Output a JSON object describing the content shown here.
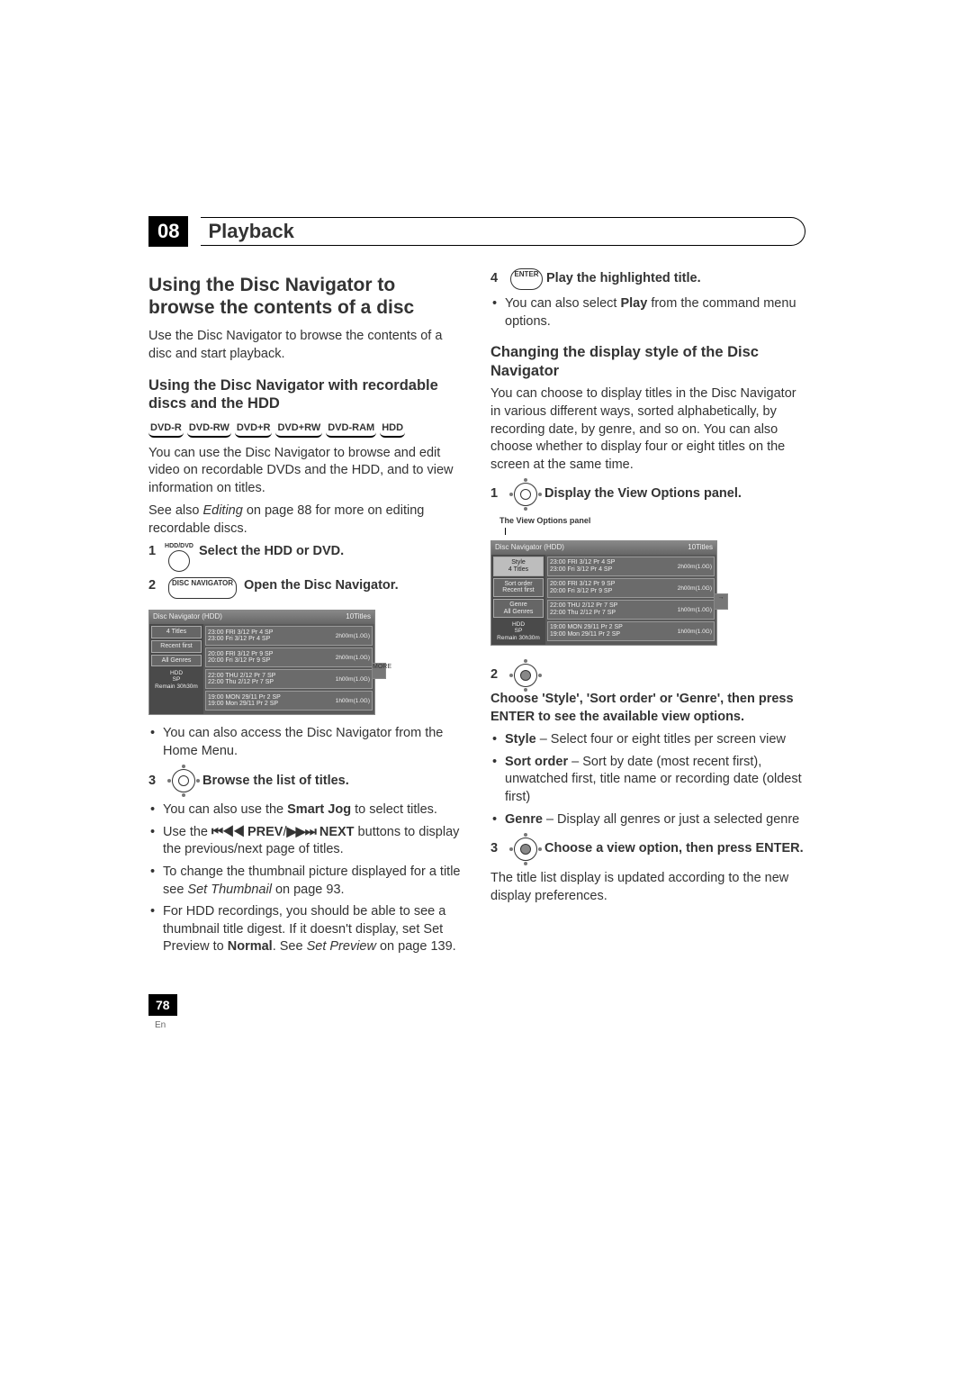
{
  "chapter": {
    "number": "08",
    "title": "Playback"
  },
  "left": {
    "main_heading": "Using the Disc Navigator to browse the contents of a disc",
    "intro": "Use the Disc Navigator to browse the contents of a disc and start playback.",
    "sub_heading": "Using the Disc Navigator with recordable discs and the HDD",
    "media_badges": [
      "DVD-R",
      "DVD-RW",
      "DVD+R",
      "DVD+RW",
      "DVD-RAM",
      "HDD"
    ],
    "para1": "You can use the Disc Navigator to browse and edit video on recordable DVDs and the HDD, and to view information on titles.",
    "para2_pre": "See also ",
    "para2_em": "Editing",
    "para2_post": " on page 88 for more on editing recordable discs.",
    "btn_hdddvd_label": "HDD/DVD",
    "step1_text": "Select the HDD or DVD.",
    "btn_discnav_label": "DISC NAVIGATOR",
    "step2_text": "Open the Disc Navigator.",
    "screenshot1": {
      "title": "Disc Navigator (HDD)",
      "count": "10Titles",
      "left_items": [
        {
          "label": "4 Titles"
        },
        {
          "label": "Recent first"
        },
        {
          "label": "All Genres"
        },
        {
          "label_top": "HDD",
          "label_mid": "SP",
          "label_bot": "Remain 30h30m"
        }
      ],
      "rows": [
        {
          "l1": "23:00 FRI  3/12  Pr 4  SP",
          "l2": "23:00 Fri  3/12  Pr 4  SP",
          "meta": "2h00m(1.0G)"
        },
        {
          "l1": "20:00 FRI  3/12  Pr 9  SP",
          "l2": "20:00 Fri  3/12  Pr 9  SP",
          "meta": "2h00m(1.0G)"
        },
        {
          "l1": "22:00 THU  2/12 Pr 7  SP",
          "l2": "22:00 Thu  2/12  Pr 7  SP",
          "meta": "1h00m(1.0G)"
        },
        {
          "l1": "19:00 MON 29/11 Pr 2  SP",
          "l2": "19:00 Mon 29/11  Pr 2  SP",
          "meta": "1h00m(1.0G)"
        }
      ],
      "more": "MORE"
    },
    "bullet_after_ss": "You can also access the Disc Navigator from the Home Menu.",
    "step3_text": "Browse the list of titles.",
    "b3_1_pre": "You can also use the ",
    "b3_1_bold": "Smart Jog",
    "b3_1_post": " to select titles.",
    "b3_2_pre": "Use the ",
    "b3_2_prev_sym": "⏮◀◀",
    "b3_2_prev": " PREV",
    "b3_2_slash": "/",
    "b3_2_next_sym": "▶▶⏭",
    "b3_2_next": " NEXT",
    "b3_2_post": " buttons to display the previous/next page of titles.",
    "b3_3_pre": "To change the thumbnail picture displayed for a title see ",
    "b3_3_em": "Set Thumbnail",
    "b3_3_post": " on page 93.",
    "b3_4_pre": "For HDD recordings, you should be able to see a thumbnail title digest. If it doesn't display, set Set Preview to ",
    "b3_4_bold": "Normal",
    "b3_4_mid": ". See ",
    "b3_4_em": "Set Preview",
    "b3_4_post": " on page 139."
  },
  "right": {
    "btn_enter": "ENTER",
    "step4_text": "Play the highlighted title.",
    "b4_pre": "You can also select ",
    "b4_bold": "Play",
    "b4_post": " from the command menu options.",
    "sub_heading": "Changing the display style of the Disc Navigator",
    "para1": "You can choose to display titles in the Disc Navigator in various different ways, sorted alphabetically, by recording date, by genre, and so on. You can also choose whether to display four or eight titles on the screen at the same time.",
    "step1_text": "Display the View Options panel.",
    "callout": "The View Options panel",
    "screenshot2": {
      "title": "Disc Navigator (HDD)",
      "count": "10Titles",
      "left_items": [
        {
          "top": "Style",
          "bot": "4 Titles"
        },
        {
          "top": "Sort order",
          "bot": "Recent first"
        },
        {
          "top": "Genre",
          "bot": "All Genres"
        },
        {
          "top": "HDD",
          "mid": "SP",
          "bot": "Remain 30h30m"
        }
      ],
      "rows": [
        {
          "l1": "23:00 FRI  3/12  Pr 4  SP",
          "l2": "23:00 Fri  3/12  Pr 4  SP",
          "meta": "2h00m(1.0G)"
        },
        {
          "l1": "20:00 FRI  3/12  Pr 9  SP",
          "l2": "20:00 Fri  3/12  Pr 9  SP",
          "meta": "2h00m(1.0G)"
        },
        {
          "l1": "22:00 THU  2/12 Pr 7  SP",
          "l2": "22:00 Thu  2/12  Pr 7  SP",
          "meta": "1h00m(1.0G)"
        },
        {
          "l1": "19:00 MON 29/11 Pr 2  SP",
          "l2": "19:00 Mon 29/11  Pr 2  SP",
          "meta": "1h00m(1.0G)"
        }
      ],
      "more": "→"
    },
    "step2_text": "Choose 'Style', 'Sort order' or 'Genre', then press ENTER to see the available view options.",
    "opt_style_b": "Style",
    "opt_style_t": " – Select four or eight titles per screen view",
    "opt_sort_b": "Sort order",
    "opt_sort_t": " – Sort by date (most recent first), unwatched first, title name or recording date (oldest first)",
    "opt_genre_b": "Genre",
    "opt_genre_t": " – Display all genres or just a selected genre",
    "step3_text": "Choose a view option, then press ENTER.",
    "para_last": "The title list display is updated according to the new display preferences."
  },
  "page_number": "78",
  "page_lang": "En"
}
